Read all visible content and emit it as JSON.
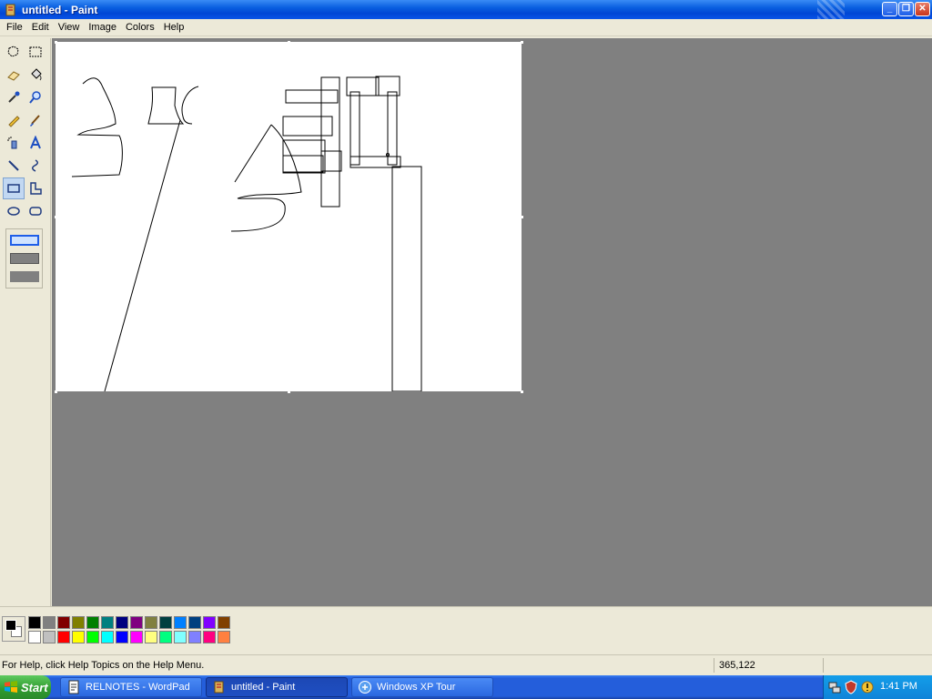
{
  "window": {
    "title": "untitled - Paint",
    "minimize_glyph": "_",
    "restore_glyph": "❐",
    "close_glyph": "✕"
  },
  "menu": {
    "items": [
      "File",
      "Edit",
      "View",
      "Image",
      "Colors",
      "Help"
    ]
  },
  "toolbox": {
    "tools": [
      "free-form-select-icon",
      "select-icon",
      "eraser-icon",
      "fill-with-color-icon",
      "pick-color-icon",
      "magnifier-icon",
      "pencil-icon",
      "brush-icon",
      "airbrush-icon",
      "text-icon",
      "line-icon",
      "curve-icon",
      "rectangle-icon",
      "polygon-icon",
      "ellipse-icon",
      "rounded-rectangle-icon"
    ],
    "selected_tool": "rectangle-icon"
  },
  "palette": {
    "foreground": "#000000",
    "background": "#ffffff",
    "row1": [
      "#000000",
      "#808080",
      "#800000",
      "#808000",
      "#008000",
      "#008080",
      "#000080",
      "#800080",
      "#808040",
      "#004040",
      "#0080ff",
      "#004080",
      "#8000ff",
      "#804000"
    ],
    "row2": [
      "#ffffff",
      "#c0c0c0",
      "#ff0000",
      "#ffff00",
      "#00ff00",
      "#00ffff",
      "#0000ff",
      "#ff00ff",
      "#ffff80",
      "#00ff80",
      "#80ffff",
      "#8080ff",
      "#ff0080",
      "#ff8040"
    ]
  },
  "status": {
    "help": "For Help, click Help Topics on the Help Menu.",
    "coords": "365,122"
  },
  "taskbar": {
    "start_label": "Start",
    "tasks": [
      {
        "label": "RELNOTES - WordPad",
        "icon": "wordpad-icon",
        "active": false
      },
      {
        "label": "untitled - Paint",
        "icon": "paint-icon",
        "active": true
      },
      {
        "label": "Windows XP Tour",
        "icon": "xp-tour-icon",
        "active": false
      }
    ],
    "tray_icons": [
      "network-icon",
      "security-icon",
      "update-icon"
    ],
    "clock": "1:41 PM"
  }
}
